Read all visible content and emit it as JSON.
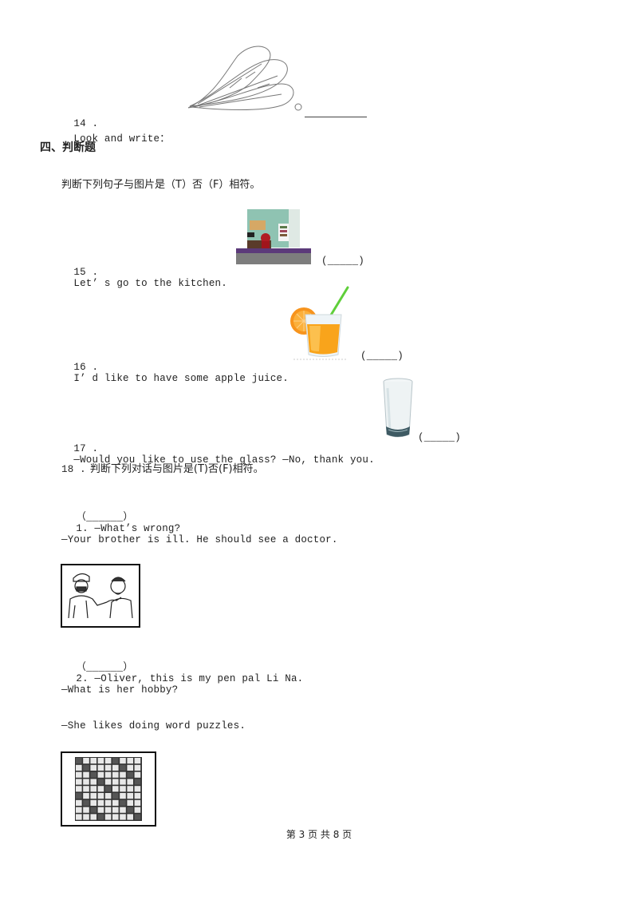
{
  "questions": {
    "q14": {
      "number": "14 .",
      "text": "Look and write：",
      "image": "vegetable-sketch",
      "answer_blank": ""
    },
    "section": {
      "title": "四、判断题",
      "instruction": "判断下列句子与图片是（T）否（F）相符。"
    },
    "q15": {
      "number": "15 .",
      "text": "Let’ s go to the kitchen.",
      "image": "kitchen-scene",
      "answer": "(_____)"
    },
    "q16": {
      "number": "16 .",
      "text": "I’ d like to have some apple juice.",
      "image": "orange-juice-glass",
      "answer": "(_____)"
    },
    "q17": {
      "number": "17 .",
      "text": "—Would you like to use the glass? —No, thank you.",
      "image": "water-glass",
      "answer": "(_____)"
    },
    "q18": {
      "number": "18 .",
      "instruction": "判断下列对话与图片是(T)否(F)相符。",
      "items": [
        {
          "blank": "（______）",
          "label": "1. —What’s wrong?",
          "reply": "—Your brother is ill. He should see a doctor.",
          "image": "doctor-patient-sketch"
        },
        {
          "blank": "（______）",
          "label": "2. —Oliver, this is my pen pal Li Na.",
          "reply1": "—What is her hobby?",
          "reply2": "—She likes doing word puzzles.",
          "image": "word-puzzle-grid"
        }
      ]
    }
  },
  "footer": {
    "page_indicator": "第 3 页 共 8 页"
  }
}
